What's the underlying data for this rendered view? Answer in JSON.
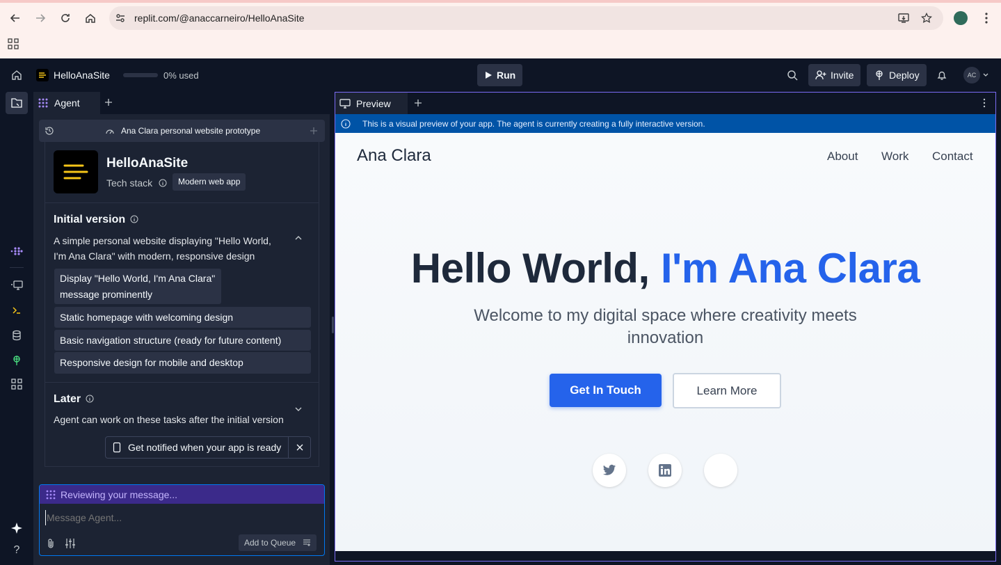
{
  "browser": {
    "url": "replit.com/@anaccarneiro/HelloAnaSite"
  },
  "topbar": {
    "project_name": "HelloAnaSite",
    "usage": "0% used",
    "usage_progress": 0,
    "run_label": "Run",
    "invite_label": "Invite",
    "deploy_label": "Deploy",
    "avatar_initials": "AC"
  },
  "agent": {
    "tab_label": "Agent",
    "checkpoint_title": "Ana Clara personal website prototype",
    "app_name": "HelloAnaSite",
    "tech_stack_label": "Tech stack",
    "tech_stack_value": "Modern web app",
    "initial_version_title": "Initial version",
    "initial_version_desc": "A simple personal website displaying \"Hello World, I'm Ana Clara\" with modern, responsive design",
    "tasks": [
      "Display \"Hello World, I'm Ana Clara\" message prominently",
      "Static homepage with welcoming design",
      "Basic navigation structure (ready for future content)",
      "Responsive design for mobile and desktop"
    ],
    "later_title": "Later",
    "later_desc": "Agent can work on these tasks after the initial version",
    "notify_label": "Get notified when your app is ready",
    "status": "Reviewing your message...",
    "input_placeholder": "Message Agent...",
    "queue_label": "Add to Queue"
  },
  "preview": {
    "tab_label": "Preview",
    "info_text": "This is a visual preview of your app. The agent is currently creating a fully interactive version.",
    "site": {
      "logo": "Ana Clara",
      "nav": [
        "About",
        "Work",
        "Contact"
      ],
      "hero_prefix": "Hello World,",
      "hero_name": "I'm Ana Clara",
      "subtitle_line1": "Welcome to my digital space where creativity meets",
      "subtitle_line2": "innovation",
      "primary_button": "Get In Touch",
      "secondary_button": "Learn More",
      "accent_color": "#2563eb"
    }
  }
}
